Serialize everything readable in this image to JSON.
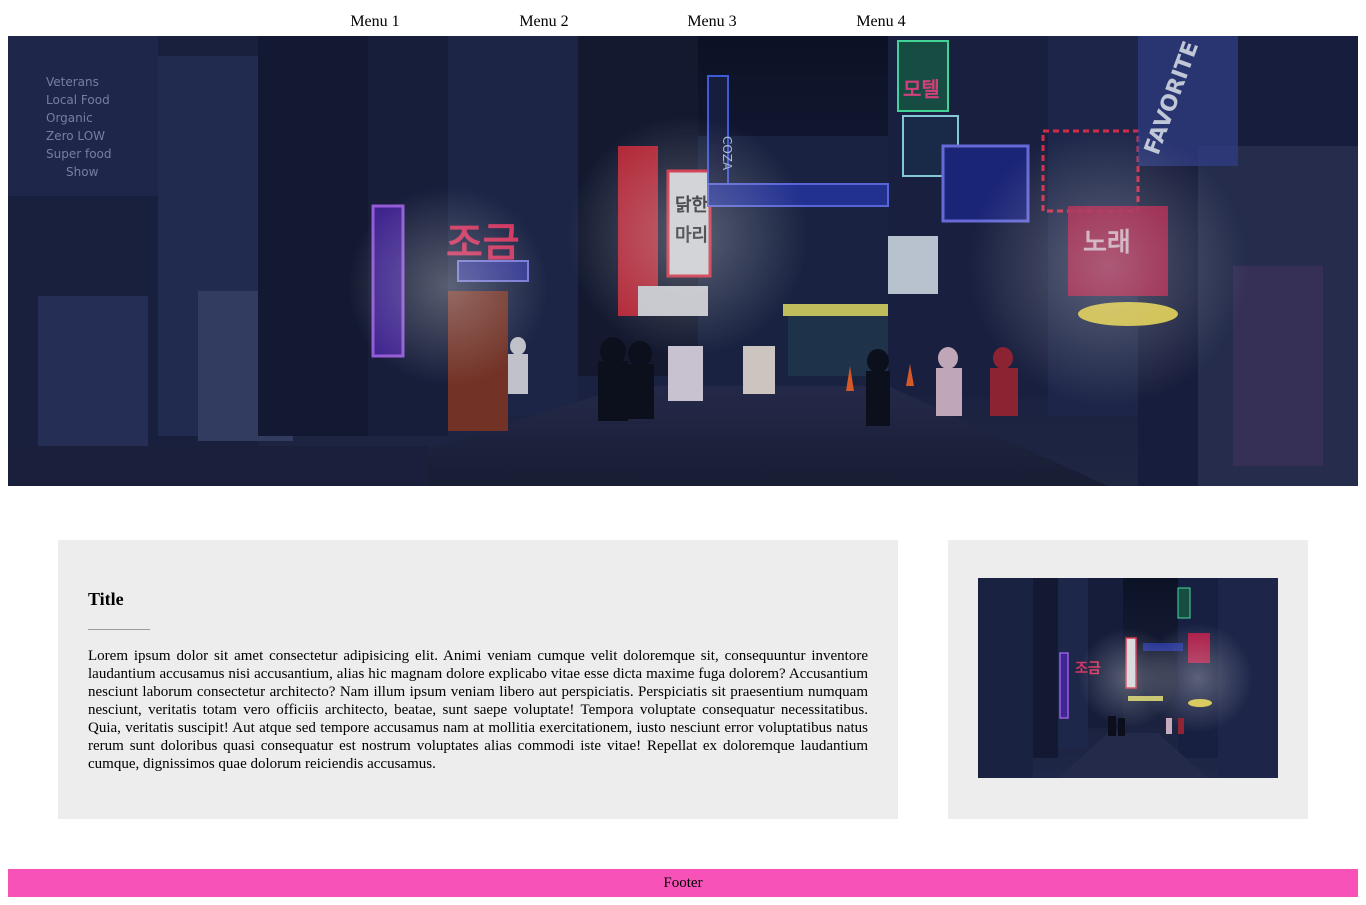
{
  "nav": {
    "items": [
      {
        "label": "Menu 1"
      },
      {
        "label": "Menu 2"
      },
      {
        "label": "Menu 3"
      },
      {
        "label": "Menu 4"
      }
    ]
  },
  "hero": {
    "image": "neon-street-night-photo",
    "sign_texts": [
      "FAVORITE COFFEE",
      "COZA",
      "Veterans Local Food Organic Zero LOW Super food Show"
    ]
  },
  "main": {
    "title": "Title",
    "body": "Lorem ipsum dolor sit amet consectetur adipisicing elit. Animi veniam cumque velit doloremque sit, consequuntur inventore laudantium accusamus nisi accusantium, alias hic magnam dolore explicabo vitae esse dicta maxime fuga dolorem? Accusantium nesciunt laborum consectetur architecto? Nam illum ipsum veniam libero aut perspiciatis. Perspiciatis sit praesentium numquam nesciunt, veritatis totam vero officiis architecto, beatae, sunt saepe voluptate! Tempora voluptate consequatur necessitatibus. Quia, veritatis suscipit! Aut atque sed tempore accusamus nam at mollitia exercitationem, iusto nesciunt error voluptatibus natus rerum sunt doloribus quasi consequatur est nostrum voluptates alias commodi iste vitae! Repellat ex doloremque laudantium cumque, dignissimos quae dolorum reiciendis accusamus."
  },
  "sidebar": {
    "image": "neon-street-night-thumbnail"
  },
  "footer": {
    "text": "Footer"
  },
  "colors": {
    "footer_bg": "#f752b8",
    "card_bg": "#ededed",
    "hero_dark": "#121a33"
  }
}
